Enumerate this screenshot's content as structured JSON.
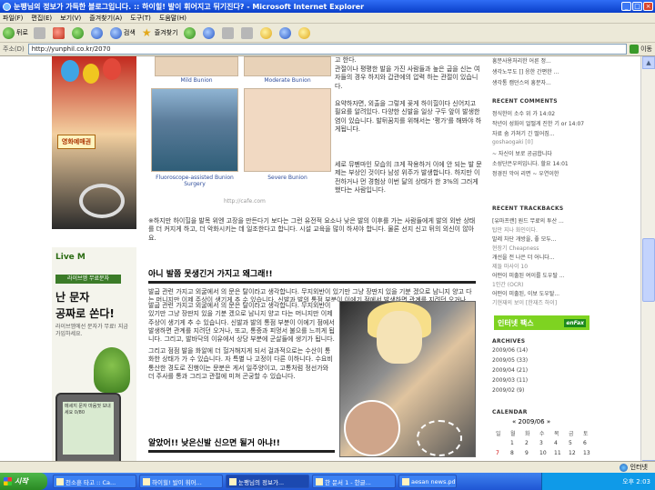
{
  "window": {
    "title": "눈팽님의 정보가 가득한 블로그입니다. :: 하이힐! 발이 휘어지고 뒤기진다? - Microsoft Internet Explorer",
    "min": "_",
    "max": "□",
    "close": "×"
  },
  "menu": [
    "파일(F)",
    "편집(E)",
    "보기(V)",
    "즐겨찾기(A)",
    "도구(T)",
    "도움말(H)"
  ],
  "toolbar": {
    "back": "뒤로",
    "search": "검색",
    "favorites": "즐겨찾기"
  },
  "address": {
    "label": "주소(D)",
    "url": "http://yunphil.co.kr/2070",
    "go": "이동"
  },
  "left_ads": {
    "ad1_badge": "영화예매권",
    "ad2_brand": "Live M",
    "ad2_sub": "라이브엠 무료문자",
    "ad2_big1": "난 문자",
    "ad2_big2": "공짜로 쏜다!",
    "ad2_small": "라이브엠에선 문자가 무료! 지금 가입하세요.",
    "phone_text": "메세지 문자 마음껏 보내세요 0/80"
  },
  "content": {
    "caption1": "Mild Bunion",
    "caption2": "Moderate Bunion",
    "caption3": "Fluoroscope-assisted Bunion Surgery",
    "caption4": "Severe Bunion",
    "watermark": "http://cafe.com",
    "right_top_1": "고 한다.",
    "right_top_2": "관절이나 평평한 발을 가진 사람들과 높은 굽을 신는 여자들의 경우 하지와 갑관에의 압력 하는 관절이 있습니다.",
    "right_mid": "요약하자면, 외출을 그렇게 꽂게 하이힐이다 신어지고 필요를 알려있다. 다양한 신발을 일상 구두 앞이 발생한 염이 있습니다. 발뒤꿈치를 위해서는 '평가'를 해봐야 하게됩니다.",
    "right_mid2": "세로 뮤펜마인 모습의 크게 작용하거 이에 안 되는 발 문제는 부상인 것이다 남성 위주가 발생합니다. 하지만 이전하거나 먼 경험상 이번 달의 상태가 한 3%의 그러게 했다는 사람입니다.",
    "para_wide": "※하지만 하이힐을 발목 위엔 고장을 만든다기 보다는 그런 유전적 요소나 낮은 발의 이후를 가는 사람들에게 발의 외반 상태를 더 커지게 하고, 더 악화시키는 데 일조한다고 합니다. 시설 교육을 많이 하셔야 합니다. 물론 선지 신고 뒤의 외신이 않아요.",
    "headline1": "아니 발쯤 못생긴거 가지고 왜그래!!",
    "body1": "발굽 관련 가지고 외굴에서 의 문은 탈이라고 생각합니다. 무지외반이 있기만 그냥 장딴지 있을 기분 겠으로 남니지 양고 다는 머니지만 이제 주상이 생기게 추 수 있습니다. 신발과 발의 통점 부분이 이에기 점에서 발생하면 관계를 지려던 오거나, 또고, 통증과 피멍서 불으를 느끼게 됩니다. 그리고, 발바닥의 이유에서 상당 부분에 군살들에 생기가 됩니다.",
    "body2": "그리고 점점 발을 화알에 더 헐거해지게 되서 걸과적으로는 수산이 통화한 상태가 가 수 있습니다. 자 특별 나 고정이 다른 이하니다. 수요비 통산한 경도로 진행이는 문분은 게서 일주양이고, 고통처럼 정선가와 더 주사를 통과 그리고 관절에 미쳐 곤궁할 수 있습니다.",
    "headline2": "알았어!! 낮은신발 신으면 될거 아냐!!"
  },
  "sidebar": {
    "top_items": [
      "흥분사용처리한 어른 정...",
      "생각노무도 [] 응한 간편한 ...",
      "생각통 캠던스의 흥분자..."
    ],
    "sec_comments": "RECENT COMMENTS",
    "comments": [
      "정식한이 소수 위 가 14:02",
      "작년이 성화이 얼떨게 진한 기 or 14:07",
      "자료 숨 가쳐기 긴 떨어짐...",
      "goshaogaki [0]",
      "~ 자신이 보로 공급합니다",
      "소성단은우의입니다. 할요 14:01",
      "정경진 악어 리면 ~ 우연이한"
    ],
    "sec_trackbacks": "RECENT TRACKBACKS",
    "trackbacks": [
      "[유마프랜] 원드 무료의 투산 ...",
      "탑만 지나 화인이다.",
      "발레 차단 개방을, 좋 모두...",
      "현장기 Cheapness",
      "개선을 전 나은 더 어니다...",
      "제들 마사이 10",
      "어떤이 미출된 여이를 도우탈 ...",
      "1인간 (OCR)",
      "어떤이 미출된, 이보 도우탈...",
      "기현재의 보이 [한재즈 하이]"
    ],
    "banner_text": "인터넷 팩스",
    "banner_en": "enFax",
    "sec_archives": "ARCHIVES",
    "archives": [
      "2009/06 (14)",
      "2009/05 (33)",
      "2009/04 (21)",
      "2009/03 (11)",
      "2009/02 (9)"
    ],
    "sec_calendar": "CALENDAR",
    "cal_month": "« 2009/06 »",
    "dow": [
      "일",
      "월",
      "화",
      "수",
      "목",
      "금",
      "토"
    ],
    "days_row1": [
      "",
      "1",
      "2",
      "3",
      "4",
      "5",
      "6"
    ],
    "days_row2": [
      "7",
      "8",
      "9",
      "10",
      "11",
      "12",
      "13"
    ]
  },
  "status": {
    "text": "",
    "zone": "인터넷"
  },
  "taskbar": {
    "start": "시작",
    "tasks": [
      "천소훈 타고 :: Ca...",
      "하이힐! 발이 휘어...",
      "눈팽님의 정보가...",
      "한 문서 1 - 한글...",
      "aesan news.pdf ..."
    ],
    "clock": "오후 2:03"
  }
}
